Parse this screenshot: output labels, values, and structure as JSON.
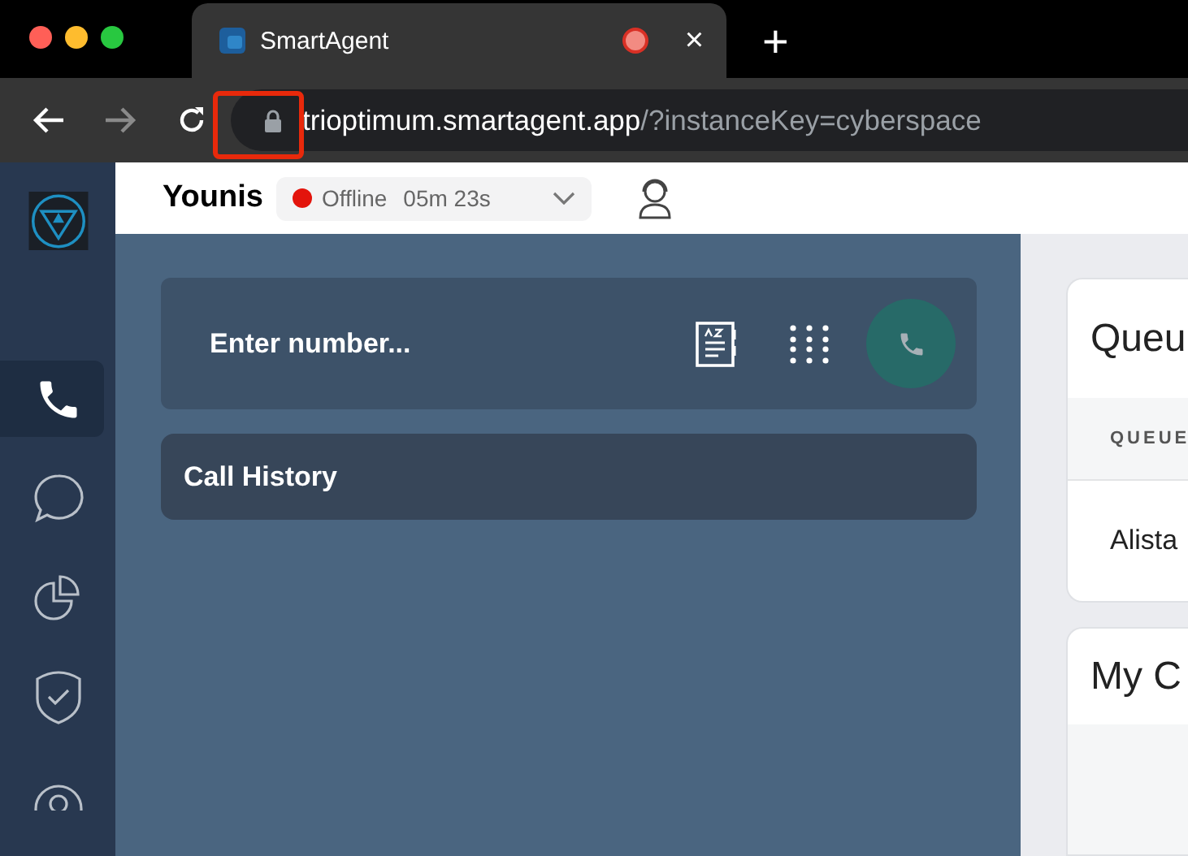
{
  "browser": {
    "tab": {
      "title": "SmartAgent",
      "recording": true,
      "close": "×"
    },
    "new_tab": "+",
    "forward_disabled": true,
    "address": {
      "host": "trioptimum.smartagent.app",
      "path": "/?instanceKey=cyberspace"
    },
    "lock_highlighted": true
  },
  "sidebar": {
    "items": [
      {
        "kind": "phone",
        "selected": true
      },
      {
        "kind": "chat",
        "selected": false
      },
      {
        "kind": "reports",
        "selected": false
      },
      {
        "kind": "shield",
        "selected": false
      },
      {
        "kind": "circle",
        "selected": false
      }
    ]
  },
  "header": {
    "agent": "Younis",
    "status": {
      "label": "Offline",
      "color": "#e3140c",
      "timer": "05m 23s"
    }
  },
  "dialer": {
    "placeholder": "Enter number..."
  },
  "call_history": {
    "title": "Call History"
  },
  "queues_card": {
    "title": "Queu",
    "column_1": "QUEUE",
    "row_1": "Alista"
  },
  "second_card": {
    "title": "My C"
  }
}
